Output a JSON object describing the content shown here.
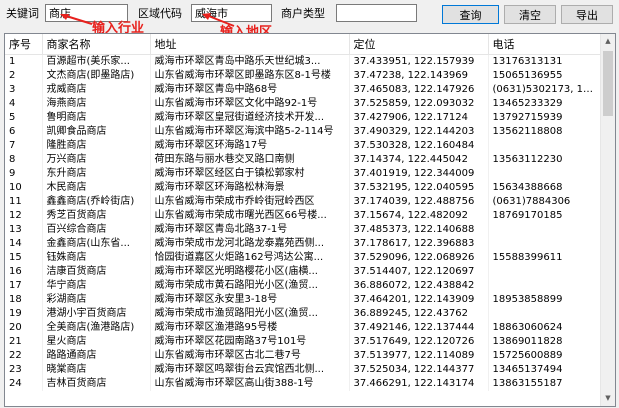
{
  "search": {
    "keyword_label": "关键词",
    "keyword_value": "商店",
    "area_label": "区域代码",
    "area_value": "威海市",
    "type_label": "商户类型",
    "type_value": ""
  },
  "buttons": {
    "query": "查询",
    "clear": "清空",
    "export": "导出"
  },
  "annotations": {
    "industry": "输入行业",
    "region": "输入地区"
  },
  "annotation_color": "#e8211d",
  "table": {
    "columns": [
      "序号",
      "商家名称",
      "地址",
      "定位",
      "电话"
    ],
    "rows": [
      [
        "1",
        "百源超市(美乐家...",
        "威海市环翠区青岛中路乐天世纪城3...",
        "37.433951, 122.157939",
        "13176313131"
      ],
      [
        "2",
        "文杰商店(即墨路店)",
        "山东省威海市环翠区即墨路东区8-1号楼",
        "37.47238, 122.143969",
        "15065136955"
      ],
      [
        "3",
        "戎威商店",
        "威海市环翠区青岛中路68号",
        "37.465083, 122.147926",
        "(0631)5302173, 136..."
      ],
      [
        "4",
        "海燕商店",
        "山东省威海市环翠区文化中路92-1号",
        "37.525859, 122.093032",
        "13465233329"
      ],
      [
        "5",
        "鲁明商店",
        "威海市环翠区皇冠街道经济技术开发...",
        "37.427906, 122.17124",
        "13792715939"
      ],
      [
        "6",
        "凯卿食品商店",
        "山东省威海市环翠区海滨中路5-2-114号",
        "37.490329, 122.144203",
        "13562118808"
      ],
      [
        "7",
        "隆胜商店",
        "威海市环翠区环海路17号",
        "37.530328, 122.160484",
        ""
      ],
      [
        "8",
        "万兴商店",
        "荷田东路与丽水巷交叉路口南侧",
        "37.14374, 122.445042",
        "13563112230"
      ],
      [
        "9",
        "东升商店",
        "威海市环翠区经区白于镇松郭家村",
        "37.401919, 122.344009",
        ""
      ],
      [
        "10",
        "木民商店",
        "威海市环翠区环海路松林海景",
        "37.532195, 122.040595",
        "15634388668"
      ],
      [
        "11",
        "鑫鑫商店(乔岭街店)",
        "山东省威海市荣成市乔岭街冠岭西区",
        "37.174039, 122.488756",
        "(0631)7884306"
      ],
      [
        "12",
        "秀芝百货商店",
        "山东省威海市荣成市曙光西区66号楼...",
        "37.15674, 122.482092",
        "18769170185"
      ],
      [
        "13",
        "百兴综合商店",
        "威海市环翠区青岛北路37-1号",
        "37.485373, 122.140688",
        ""
      ],
      [
        "14",
        "金鑫商店(山东省...",
        "威海市荣成市龙河北路龙泰嘉苑西侧...",
        "37.178617, 122.396883",
        ""
      ],
      [
        "15",
        "钰姝商店",
        "恰园街道嘉区火炬路162号鸿达公寓...",
        "37.529096, 122.068926",
        "15588399611"
      ],
      [
        "16",
        "洁康百货商店",
        "威海市环翠区光明路樱花小区(庙横...",
        "37.514407, 122.120697",
        ""
      ],
      [
        "17",
        "华宁商店",
        "威海市荣成市黄石路阳光小区(渔贸...",
        "36.886072, 122.438842",
        ""
      ],
      [
        "18",
        "彩湖商店",
        "威海市环翠区永安里3-18号",
        "37.464201, 122.143909",
        "18953858899"
      ],
      [
        "19",
        "港湖小宇百货商店",
        "威海市荣成市渔贸路阳光小区(渔贸...",
        "36.889245, 122.43762",
        ""
      ],
      [
        "20",
        "全美商店(渔港路店)",
        "威海市环翠区渔港路95号楼",
        "37.492146, 122.137444",
        "18863060624"
      ],
      [
        "21",
        "星火商店",
        "威海市环翠区花园南路37号101号",
        "37.517649, 122.120726",
        "13869011828"
      ],
      [
        "22",
        "路路通商店",
        "山东省威海市环翠区古北二巷7号",
        "37.513977, 122.114089",
        "15725600889"
      ],
      [
        "23",
        "晓棠商店",
        "威海市环翠区鸣翠街台云宾馆西北侧...",
        "37.525034, 122.144377",
        "13465137494"
      ],
      [
        "24",
        "吉林百货商店",
        "山东省威海市环翠区高山街388-1号",
        "37.466291, 122.143174",
        "13863155187"
      ]
    ]
  },
  "icons": {
    "scroll_up": "scroll-up-arrow-icon",
    "scroll_down": "scroll-down-arrow-icon"
  }
}
